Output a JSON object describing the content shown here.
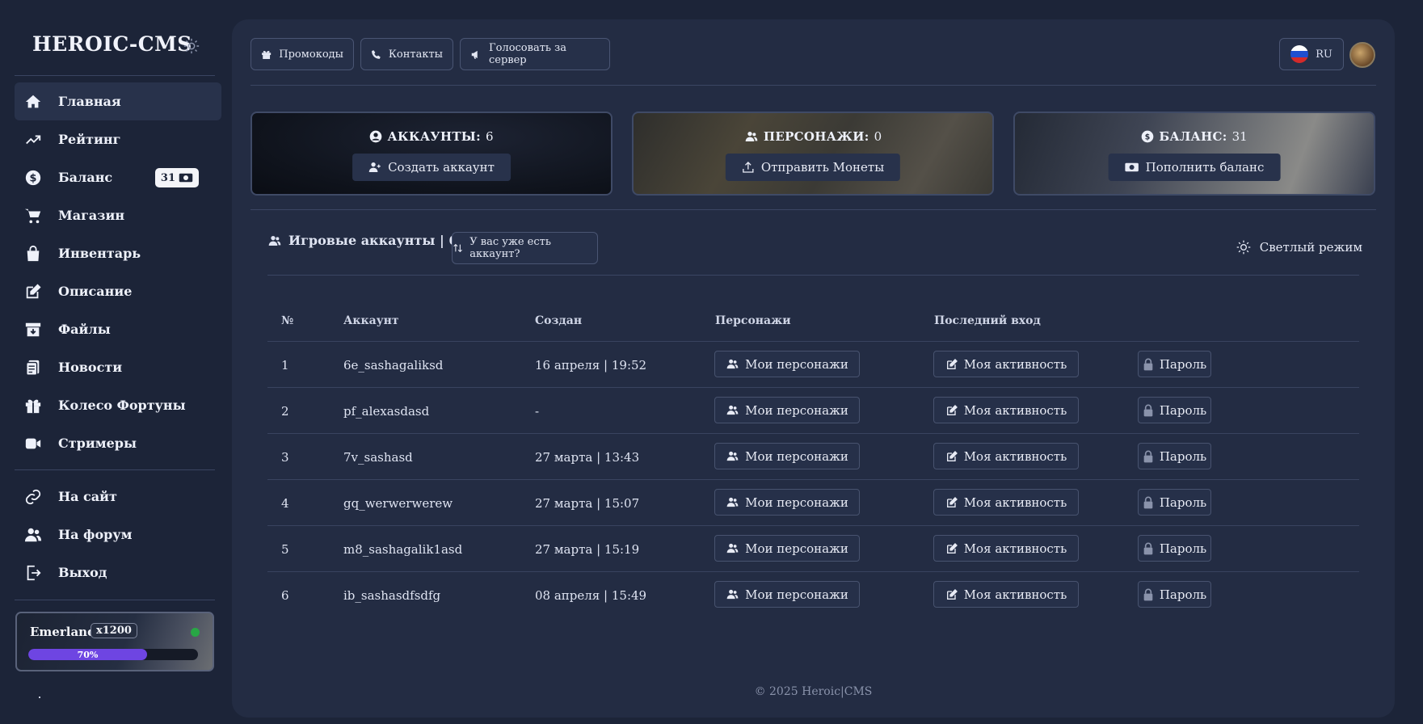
{
  "sidebar": {
    "brand": "HEROIC-CMS",
    "items": [
      {
        "label": "Главная"
      },
      {
        "label": "Рейтинг"
      },
      {
        "label": "Баланс",
        "badge": "31"
      },
      {
        "label": "Магазин"
      },
      {
        "label": "Инвентарь"
      },
      {
        "label": "Описание"
      },
      {
        "label": "Файлы"
      },
      {
        "label": "Новости"
      },
      {
        "label": "Колесо Фортуны"
      },
      {
        "label": "Стримеры"
      }
    ],
    "links": [
      {
        "label": "На сайт"
      },
      {
        "label": "На форум"
      },
      {
        "label": "Выход"
      }
    ],
    "server": {
      "name": "Emerland",
      "rate": "x1200",
      "load_label": "70%",
      "load": 0.7
    },
    "dot": "."
  },
  "topbar": {
    "promo": "Промокоды",
    "contacts": "Контакты",
    "vote": "Голосовать за сервер",
    "lang": "RU"
  },
  "stats": {
    "accounts": {
      "label": "АККАУНТЫ:",
      "value": "6",
      "button": "Создать аккаунт"
    },
    "characters": {
      "label": "ПЕРСОНАЖИ:",
      "value": "0",
      "button": "Отправить Монеты"
    },
    "balance": {
      "label": "БАЛАНС:",
      "value": "31",
      "button": "Пополнить баланс"
    }
  },
  "accounts_section": {
    "title": "Игровые аккаунты | 6 / 7 |",
    "have_account": "У вас уже есть аккаунт?",
    "light_mode": "Светлый режим"
  },
  "table": {
    "headers": [
      "№",
      "Аккаунт",
      "Создан",
      "Персонажи",
      "Последний вход"
    ],
    "btn_characters": "Мои персонажи",
    "btn_activity": "Моя активность",
    "btn_password": "Пароль",
    "rows": [
      {
        "n": "1",
        "account": "6e_sashagaliksd",
        "created": "16 апреля | 19:52"
      },
      {
        "n": "2",
        "account": "pf_alexasdasd",
        "created": "-"
      },
      {
        "n": "3",
        "account": "7v_sashasd",
        "created": "27 марта | 13:43"
      },
      {
        "n": "4",
        "account": "gq_werwerwerew",
        "created": "27 марта | 15:07"
      },
      {
        "n": "5",
        "account": "m8_sashagalik1asd",
        "created": "27 марта | 15:19"
      },
      {
        "n": "6",
        "account": "ib_sashasdfsdfg",
        "created": "08 апреля | 15:49"
      }
    ]
  },
  "footer": "© 2025 Heroic|CMS",
  "colors": {
    "bg": "#1c2438",
    "panel": "#232c43",
    "accent": "#6e45e2",
    "online": "#28a745"
  }
}
